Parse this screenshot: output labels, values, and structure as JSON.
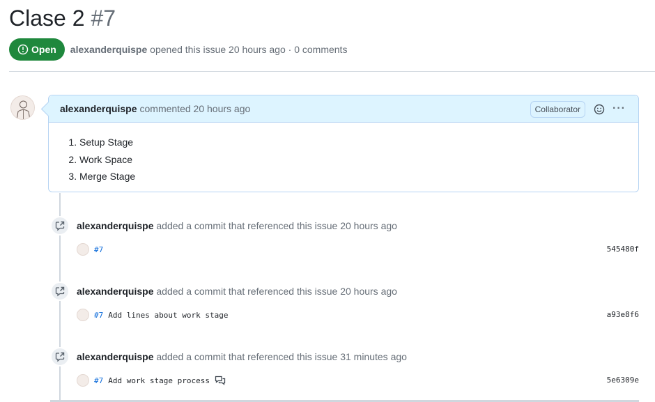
{
  "issue": {
    "title": "Clase 2",
    "number": "#7",
    "state": "Open",
    "author": "alexanderquispe",
    "opened_text": "opened this issue 20 hours ago · 0 comments"
  },
  "comment": {
    "author": "alexanderquispe",
    "action": "commented 20 hours ago",
    "role_badge": "Collaborator",
    "menu_label": "···",
    "items": [
      "Setup Stage",
      "Work Space",
      "Merge Stage"
    ]
  },
  "events": [
    {
      "author": "alexanderquispe",
      "action": "added a commit that referenced this issue 20 hours ago",
      "ref": "#7",
      "message": "",
      "sha": "545480f"
    },
    {
      "author": "alexanderquispe",
      "action": "added a commit that referenced this issue 20 hours ago",
      "ref": "#7",
      "message": "Add lines about work stage",
      "sha": "a93e8f6"
    },
    {
      "author": "alexanderquispe",
      "action": "added a commit that referenced this issue 31 minutes ago",
      "ref": "#7",
      "message": "Add work stage process",
      "sha": "5e6309e"
    }
  ],
  "colors": {
    "open_green": "#1f883d",
    "link_blue": "#0969da",
    "header_blue": "#ddf4ff"
  }
}
